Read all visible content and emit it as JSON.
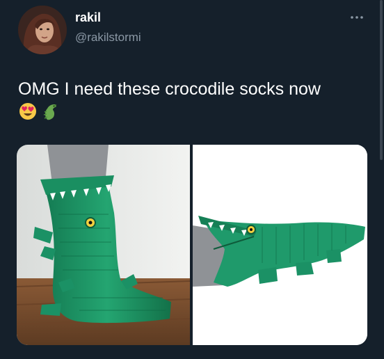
{
  "tweet": {
    "author": {
      "name": "rakil",
      "handle": "@rakilstormi"
    },
    "more_icon": "more-horizontal-icon",
    "text": "OMG I need these crocodile socks now",
    "emojis": [
      "heart-eyes-emoji",
      "crocodile-emoji"
    ],
    "media": [
      {
        "kind": "photo",
        "subject": "standing-crocodile-socks"
      },
      {
        "kind": "photo",
        "subject": "crocodile-sock-side-view"
      }
    ]
  },
  "colors": {
    "background": "#15202b",
    "text_primary": "#ffffff",
    "text_secondary": "#8b98a5",
    "sock_green": "#1f9a6b"
  }
}
